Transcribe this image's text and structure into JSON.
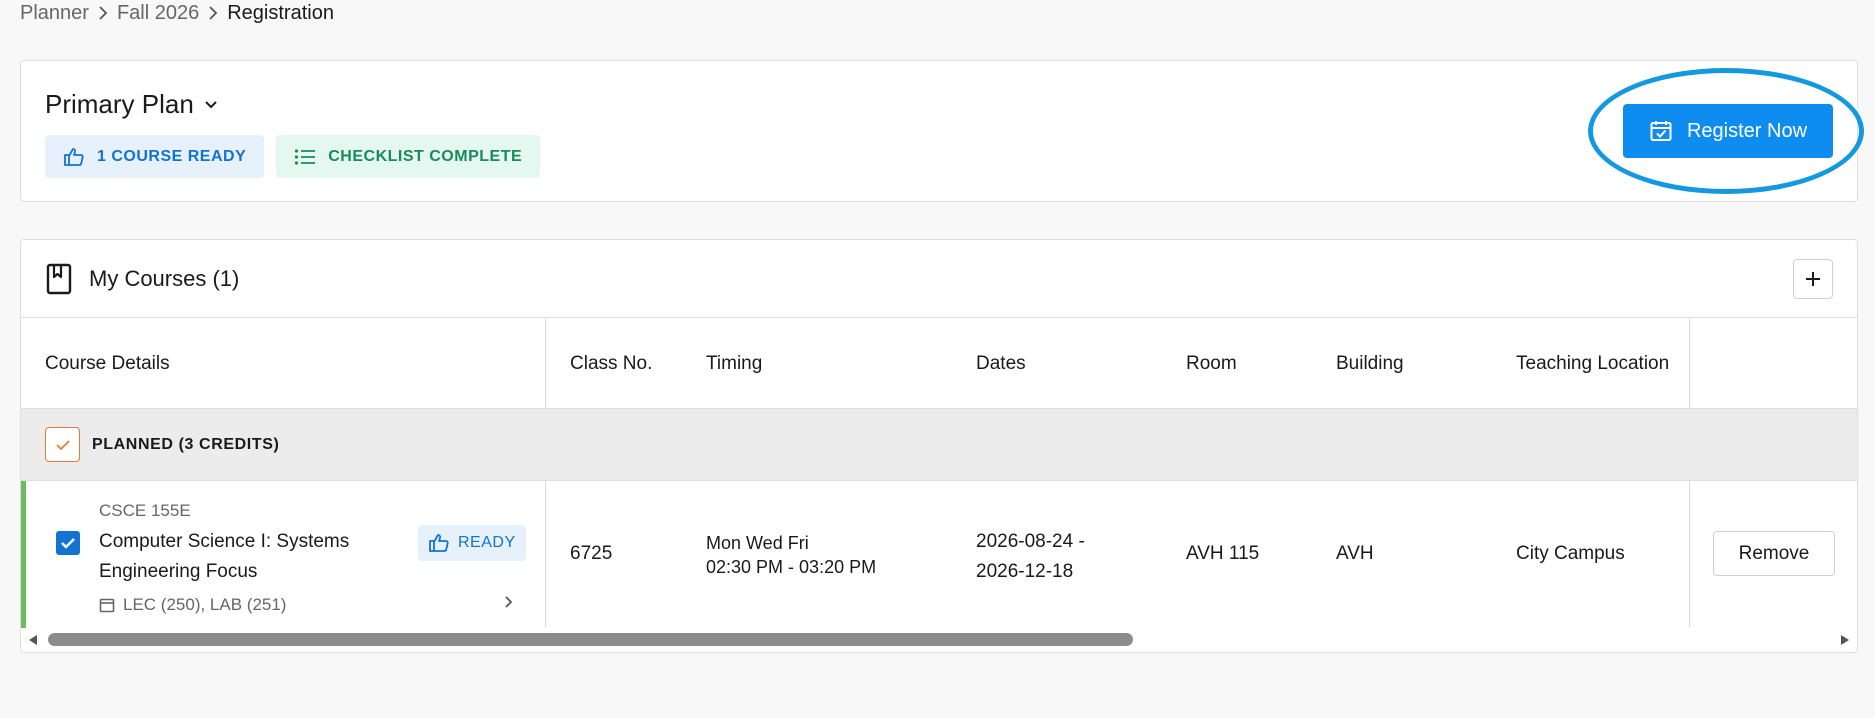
{
  "breadcrumb": {
    "items": [
      "Planner",
      "Fall 2026",
      "Registration"
    ]
  },
  "plan": {
    "title": "Primary Plan",
    "badge_ready": "1 COURSE READY",
    "badge_checklist": "CHECKLIST COMPLETE",
    "register_label": "Register Now"
  },
  "courses": {
    "title": "My Courses (1)",
    "columns": [
      "Course Details",
      "Class No.",
      "Timing",
      "Dates",
      "Room",
      "Building",
      "Teaching Location"
    ],
    "group_label": "PLANNED (3 CREDITS)",
    "rows": [
      {
        "code": "CSCE 155E",
        "name": "Computer Science I: Systems Engineering Focus",
        "status": "READY",
        "sections": "LEC (250), LAB (251)",
        "class_no": "6725",
        "days": "Mon Wed Fri",
        "time": "02:30 PM - 03:20 PM",
        "date_start": "2026-08-24 -",
        "date_end": "2026-12-18",
        "room": "AVH 115",
        "building": "AVH",
        "location": "City Campus",
        "remove_label": "Remove"
      }
    ]
  },
  "colors": {
    "primary": "#0f8cf0",
    "ready_text": "#1273d0",
    "checklist_text": "#1a8a5a",
    "planned_accent": "#e87a3a",
    "row_accent": "#6bbf5a",
    "highlight_ring": "#1498e0"
  }
}
